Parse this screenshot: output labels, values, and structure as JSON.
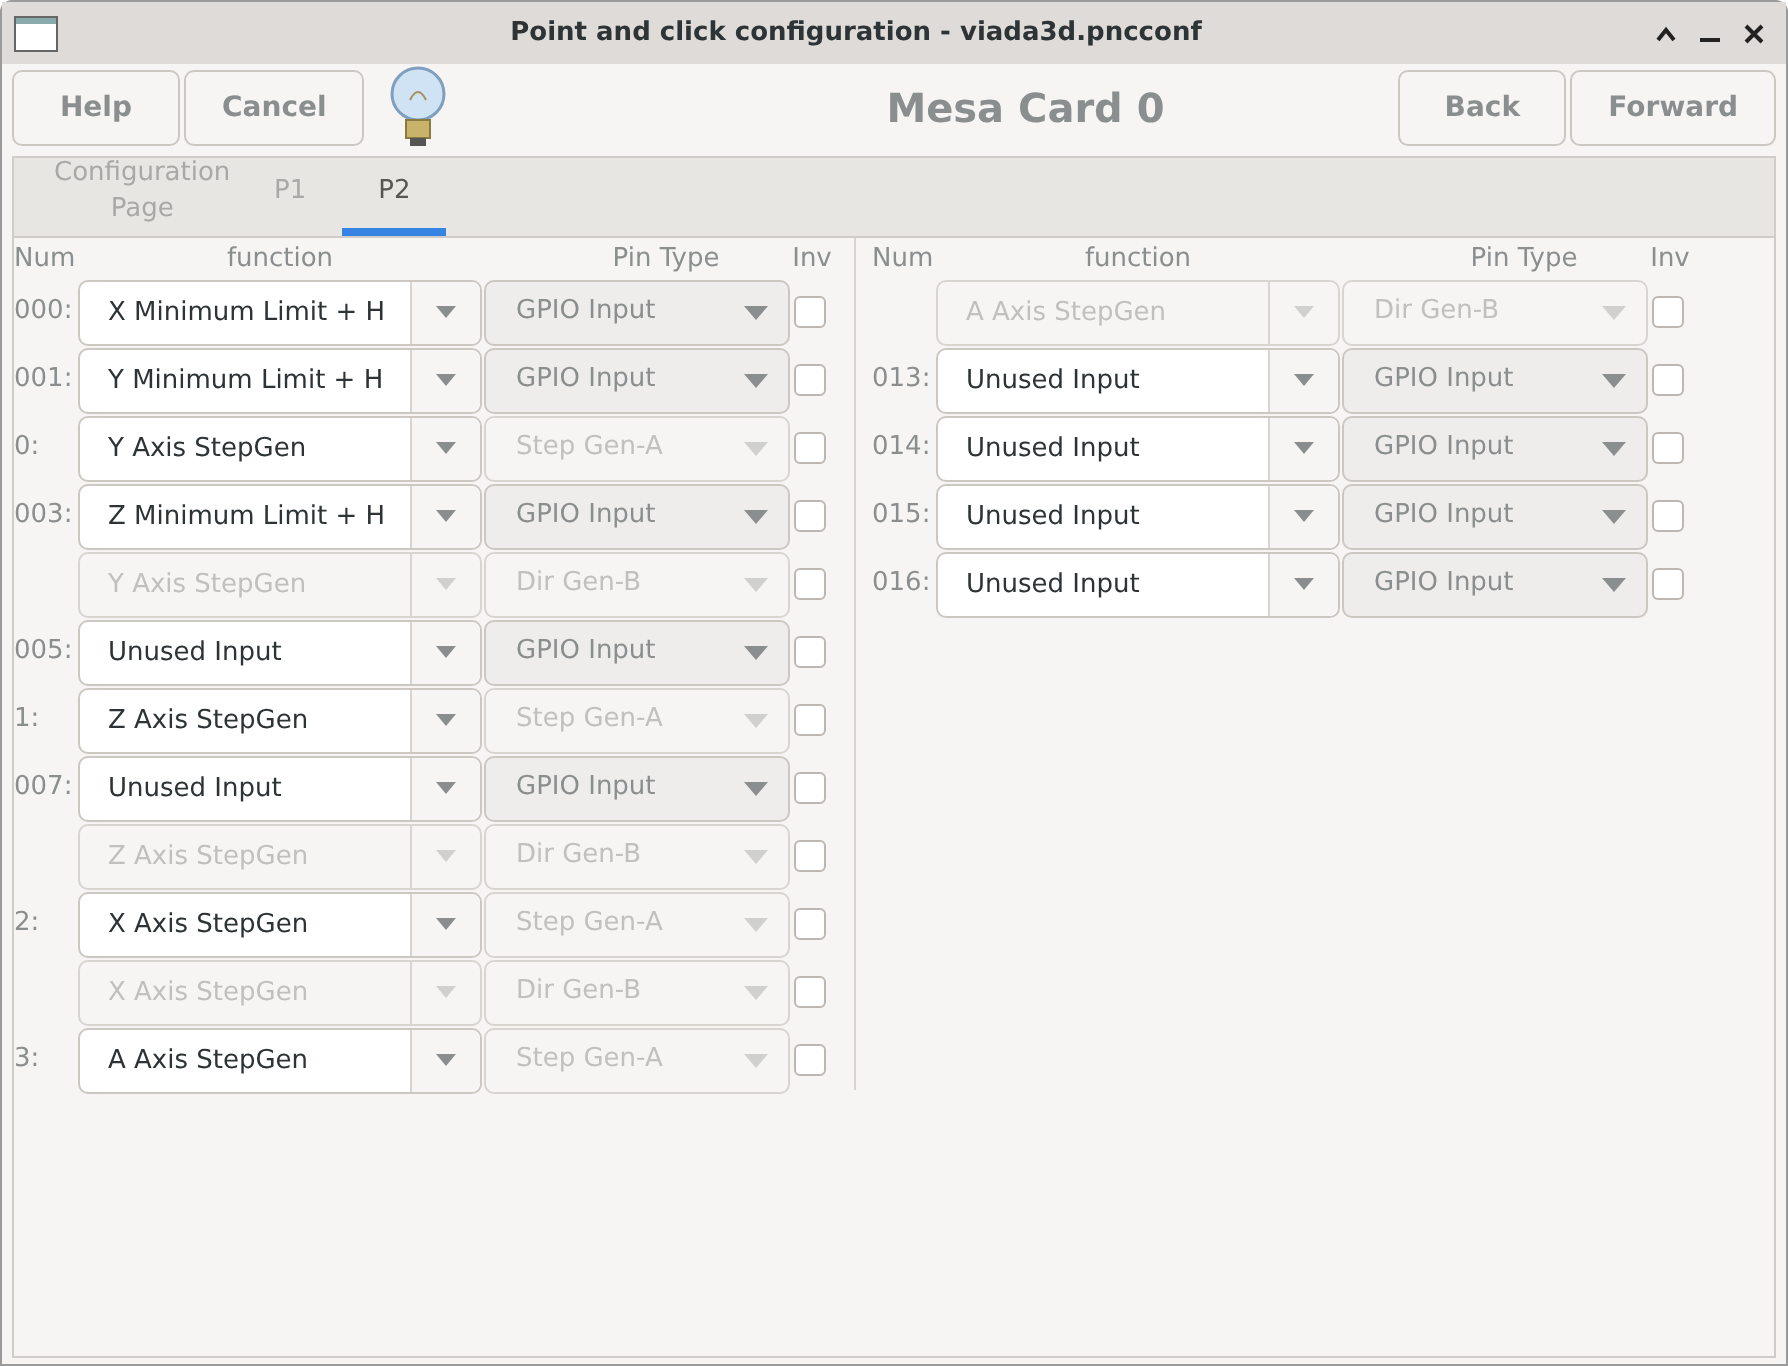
{
  "window": {
    "title": "Point and click configuration - viada3d.pncconf"
  },
  "toolbar": {
    "left_buttons": [
      "Help",
      "Cancel"
    ],
    "heading": "Mesa Card 0",
    "right_buttons": [
      "Back",
      "Forward"
    ]
  },
  "tabs": [
    {
      "label": "Configuration Page",
      "selected": false
    },
    {
      "label": "P1",
      "selected": false
    },
    {
      "label": "P2",
      "selected": true
    }
  ],
  "columns": [
    {
      "headers": [
        "Num",
        "function",
        "Pin Type",
        "Inv"
      ],
      "rows": [
        {
          "num": "000:",
          "function": "X Minimum Limit + H",
          "function_disabled": false,
          "pin_type": "GPIO Input",
          "pin_type_disabled": false,
          "inv": false
        },
        {
          "num": "001:",
          "function": "Y Minimum Limit + H",
          "function_disabled": false,
          "pin_type": "GPIO Input",
          "pin_type_disabled": false,
          "inv": false
        },
        {
          "num": "0:",
          "function": "Y Axis StepGen",
          "function_disabled": false,
          "pin_type": "Step Gen-A",
          "pin_type_disabled": true,
          "inv": false
        },
        {
          "num": "003:",
          "function": "Z Minimum Limit + H",
          "function_disabled": false,
          "pin_type": "GPIO Input",
          "pin_type_disabled": false,
          "inv": false
        },
        {
          "function": "Y Axis StepGen",
          "function_disabled": true,
          "pin_type": "Dir Gen-B",
          "pin_type_disabled": true,
          "inv": false
        },
        {
          "num": "005:",
          "function": "Unused Input",
          "function_disabled": false,
          "pin_type": "GPIO Input",
          "pin_type_disabled": false,
          "inv": false
        },
        {
          "num": "1:",
          "function": "Z Axis StepGen",
          "function_disabled": false,
          "pin_type": "Step Gen-A",
          "pin_type_disabled": true,
          "inv": false
        },
        {
          "num": "007:",
          "function": "Unused Input",
          "function_disabled": false,
          "pin_type": "GPIO Input",
          "pin_type_disabled": false,
          "inv": false
        },
        {
          "function": "Z Axis StepGen",
          "function_disabled": true,
          "pin_type": "Dir Gen-B",
          "pin_type_disabled": true,
          "inv": false
        },
        {
          "num": "2:",
          "function": "X Axis StepGen",
          "function_disabled": false,
          "pin_type": "Step Gen-A",
          "pin_type_disabled": true,
          "inv": false
        },
        {
          "function": "X Axis StepGen",
          "function_disabled": true,
          "pin_type": "Dir Gen-B",
          "pin_type_disabled": true,
          "inv": false
        },
        {
          "num": "3:",
          "function": "A Axis StepGen",
          "function_disabled": false,
          "pin_type": "Step Gen-A",
          "pin_type_disabled": true,
          "inv": false
        }
      ]
    },
    {
      "headers": [
        "Num",
        "function",
        "Pin Type",
        "Inv"
      ],
      "rows": [
        {
          "function": "A Axis StepGen",
          "function_disabled": true,
          "pin_type": "Dir Gen-B",
          "pin_type_disabled": true,
          "inv": false
        },
        {
          "num": "013:",
          "function": "Unused Input",
          "function_disabled": false,
          "pin_type": "GPIO Input",
          "pin_type_disabled": false,
          "inv": false
        },
        {
          "num": "014:",
          "function": "Unused Input",
          "function_disabled": false,
          "pin_type": "GPIO Input",
          "pin_type_disabled": false,
          "inv": false
        },
        {
          "num": "015:",
          "function": "Unused Input",
          "function_disabled": false,
          "pin_type": "GPIO Input",
          "pin_type_disabled": false,
          "inv": false
        },
        {
          "num": "016:",
          "function": "Unused Input",
          "function_disabled": false,
          "pin_type": "GPIO Input",
          "pin_type_disabled": false,
          "inv": false
        }
      ]
    }
  ]
}
